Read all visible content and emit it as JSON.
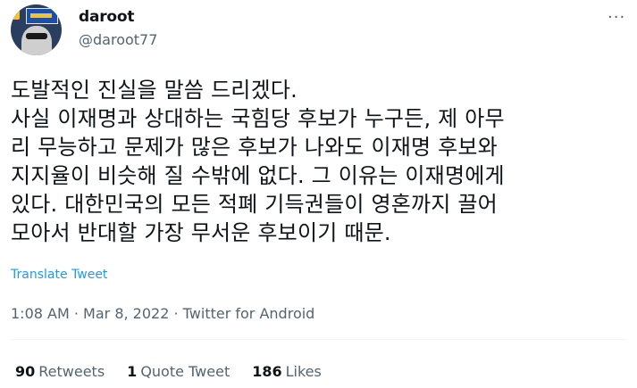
{
  "user": {
    "display_name": "daroot",
    "handle": "@daroot77"
  },
  "menu": {
    "more_label": "···"
  },
  "tweet": {
    "lines": [
      "도발적인 진실을 말씀 드리겠다.",
      "사실 이재명과 상대하는 국힘당 후보가 누구든, 제 아무",
      "리 무능하고 문제가 많은 후보가 나와도 이재명 후보와",
      "지지율이 비슷해 질 수밖에 없다. 그 이유는 이재명에게",
      "있다. 대한민국의 모든 적폐 기득권들이 영혼까지 끌어",
      "모아서 반대할 가장 무서운 후보이기 때문."
    ],
    "translate_label": "Translate Tweet",
    "time": "1:08 AM",
    "date": "Mar 8, 2022",
    "separator": "·",
    "source": "Twitter for Android"
  },
  "stats": {
    "retweets_count": "90",
    "retweets_label": "Retweets",
    "quotes_count": "1",
    "quotes_label": "Quote Tweet",
    "likes_count": "186",
    "likes_label": "Likes"
  }
}
